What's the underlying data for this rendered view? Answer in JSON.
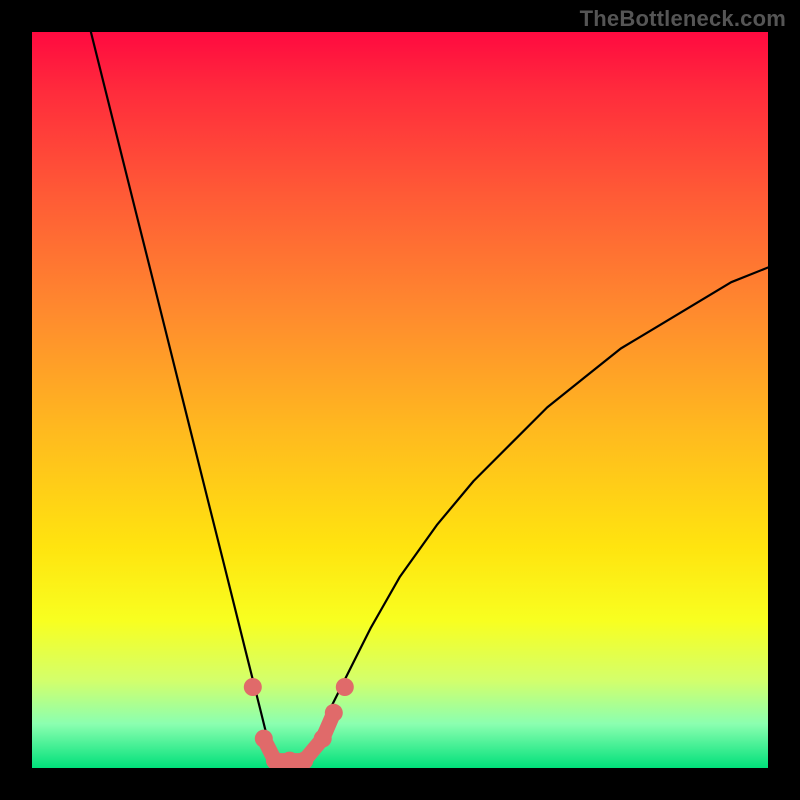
{
  "attribution": "TheBottleneck.com",
  "colors": {
    "frame": "#000000",
    "curve": "#000000",
    "marker_fill": "#e06a6a",
    "marker_stroke": "#c94f4f",
    "gradient_top": "#ff0a40",
    "gradient_bottom": "#00e07a"
  },
  "chart_data": {
    "type": "line",
    "title": "",
    "xlabel": "",
    "ylabel": "",
    "xlim": [
      0,
      100
    ],
    "ylim": [
      0,
      100
    ],
    "grid": false,
    "legend": false,
    "annotations": [],
    "series": [
      {
        "name": "curve",
        "x": [
          8,
          10,
          12,
          14,
          16,
          18,
          20,
          22,
          24,
          26,
          28,
          29,
          30,
          31,
          32,
          33,
          34,
          35,
          36,
          37,
          38,
          40,
          42,
          44,
          46,
          50,
          55,
          60,
          65,
          70,
          75,
          80,
          85,
          90,
          95,
          100
        ],
        "y": [
          100,
          92,
          84,
          76,
          68,
          60,
          52,
          44,
          36,
          28,
          20,
          16,
          12,
          8,
          4,
          1,
          0,
          0,
          0,
          1,
          3,
          7,
          11,
          15,
          19,
          26,
          33,
          39,
          44,
          49,
          53,
          57,
          60,
          63,
          66,
          68
        ]
      }
    ],
    "markers": [
      {
        "x": 30.0,
        "y": 11.0
      },
      {
        "x": 31.5,
        "y": 4.0
      },
      {
        "x": 33.0,
        "y": 1.0
      },
      {
        "x": 35.0,
        "y": 1.0
      },
      {
        "x": 37.0,
        "y": 1.0
      },
      {
        "x": 39.5,
        "y": 4.0
      },
      {
        "x": 41.0,
        "y": 7.5
      },
      {
        "x": 42.5,
        "y": 11.0
      }
    ]
  }
}
